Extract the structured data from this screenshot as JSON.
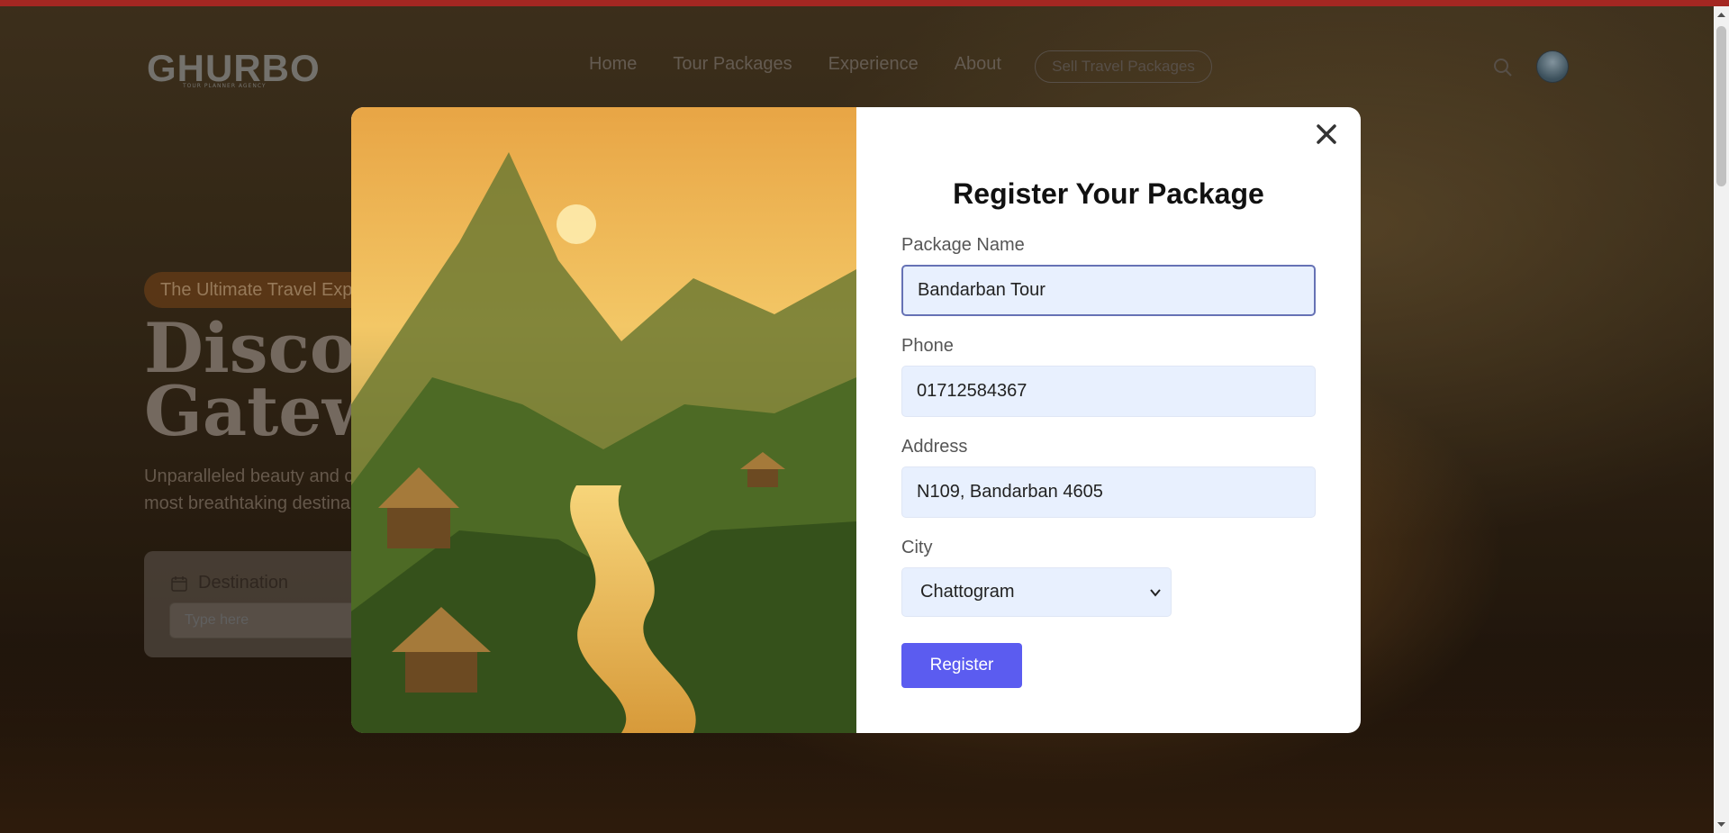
{
  "nav": {
    "logo": "GHURBO",
    "logo_sub": "TOUR PLANNER AGENCY",
    "links": [
      "Home",
      "Tour Packages",
      "Experience",
      "About"
    ],
    "sell_button": "Sell Travel Packages"
  },
  "hero": {
    "tag": "The Ultimate Travel Expe",
    "title_line1": "Discove",
    "title_line2": "Gatewa",
    "subtitle_line1": "Unparalleled beauty and c",
    "subtitle_line2": "most breathtaking destina",
    "destination_label": "Destination",
    "destination_placeholder": "Type here"
  },
  "modal": {
    "title": "Register Your Package",
    "fields": {
      "package_name": {
        "label": "Package Name",
        "value": "Bandarban Tour"
      },
      "phone": {
        "label": "Phone",
        "value": "01712584367"
      },
      "address": {
        "label": "Address",
        "value": "N109, Bandarban 4605"
      },
      "city": {
        "label": "City",
        "value": "Chattogram"
      }
    },
    "register_button": "Register"
  },
  "colors": {
    "accent": "#5b5cf0",
    "input_bg": "#e8f0fe",
    "top_bar": "#c8302a"
  }
}
